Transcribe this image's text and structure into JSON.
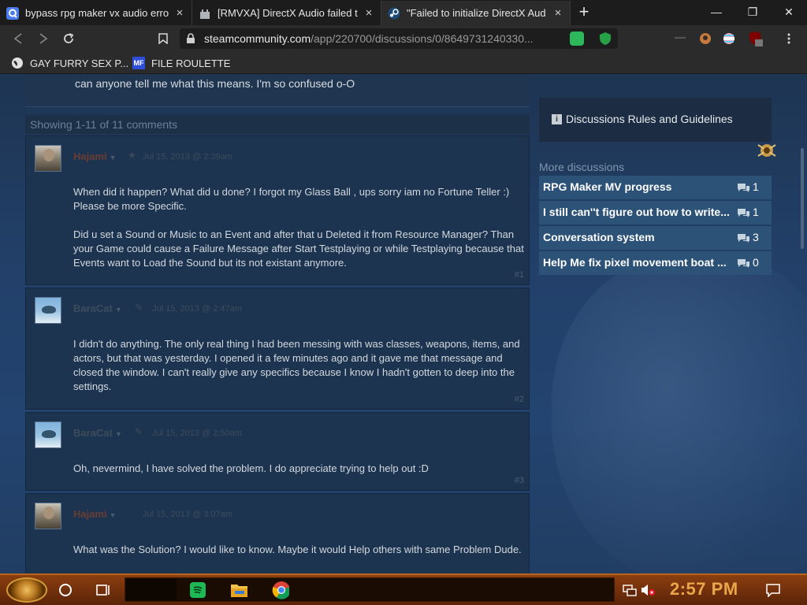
{
  "tabs": [
    {
      "title": "bypass rpg maker vx audio error",
      "favicon": "search-q-icon",
      "close": "×"
    },
    {
      "title": "[RMVXA] DirectX Audio failed t",
      "favicon": "castle-icon",
      "close": "×"
    },
    {
      "title": "\"Failed to initialize DirectX Aud",
      "favicon": "steam-icon",
      "close": "×"
    }
  ],
  "new_tab_label": "+",
  "window_controls": {
    "minimize": "—",
    "restore": "❐",
    "close": "✕"
  },
  "address_bar": {
    "host": "steamcommunity.com",
    "path": "/app/220700/discussions/0/8649731240330..."
  },
  "bookmarks": [
    {
      "label": "GAY FURRY SEX P...",
      "icon": "globe-icon"
    },
    {
      "label": "FILE ROULETTE",
      "icon": "mf-icon",
      "icon_text": "MF"
    }
  ],
  "post_tail_text": "can anyone tell me what this means. I'm so confused o-O",
  "showing_text": "Showing 1-11 of 11 comments",
  "comments": [
    {
      "author": "Hajami",
      "dropdown": "▼",
      "badge": "★",
      "timestamp": "Jul 15, 2013 @ 2:39am",
      "paragraphs": [
        "When did it happen? What did u done? I forgot my Glass Ball , ups sorry iam no Fortune Teller :) Please be more Specific.",
        "Did u set a Sound or Music to an Event and after that u Deleted it from Resource Manager? Than your Game could cause a Failure Message after Start Testplaying or while Testplaying because that Events want to Load the Sound but its not existant anymore."
      ],
      "number": "#1"
    },
    {
      "author": "BaraCat",
      "dropdown": "▼",
      "badge": "✎",
      "timestamp": "Jul 15, 2013 @ 2:47am",
      "paragraphs": [
        "I didn't do anything. The only real thing I had been messing with was classes, weapons, items, and actors, but that was yesterday. I opened it a few minutes ago and it gave me that message and closed the window. I can't really give any specifics because I know I hadn't gotten to deep into the settings."
      ],
      "number": "#2"
    },
    {
      "author": "BaraCat",
      "dropdown": "▼",
      "badge": "✎",
      "timestamp": "Jul 15, 2013 @ 2:50am",
      "paragraphs": [
        "Oh, nevermind, I have solved the problem. I do appreciate trying to help out :D"
      ],
      "number": "#3"
    },
    {
      "author": "Hajami",
      "dropdown": "▼",
      "badge": "",
      "timestamp": "Jul 15, 2013 @ 3:07am",
      "paragraphs": [
        "What was the Solution? I would like to know. Maybe it would Help others with same Problem Dude."
      ],
      "number": ""
    }
  ],
  "sidebar": {
    "rules_label": "Discussions Rules and Guidelines",
    "rules_icon_text": "i",
    "more_title": "More discussions",
    "discussions": [
      {
        "title": "RPG Maker MV progress",
        "count": "1"
      },
      {
        "title": "I still can''t figure out how to write...",
        "count": "1"
      },
      {
        "title": "Conversation system",
        "count": "3"
      },
      {
        "title": "Help Me fix pixel movement boat ...",
        "count": "0"
      }
    ]
  },
  "taskbar": {
    "clock": "2:57 PM",
    "accent": "#e9a64b"
  },
  "colors": {
    "steam_bg": "#1b2838",
    "discussion_item_bg": "#2d5278",
    "taskbar_top": "#8c3e0f"
  }
}
